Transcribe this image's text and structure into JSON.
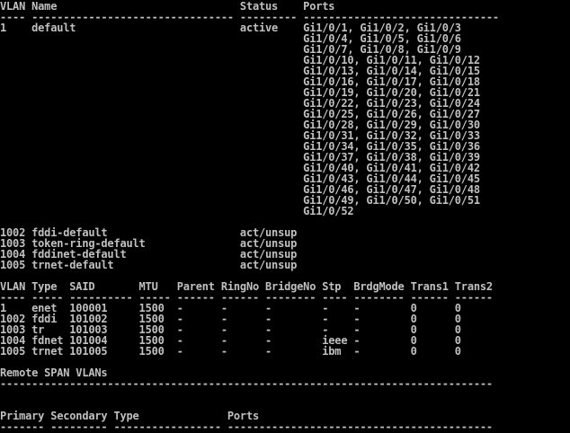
{
  "terminal": {
    "lines": [
      "VLAN Name                             Status    Ports",
      "---- -------------------------------- --------- -------------------------------",
      "1    default                          active    Gi1/0/1, Gi1/0/2, Gi1/0/3",
      "                                                Gi1/0/4, Gi1/0/5, Gi1/0/6",
      "                                                Gi1/0/7, Gi1/0/8, Gi1/0/9",
      "                                                Gi1/0/10, Gi1/0/11, Gi1/0/12",
      "                                                Gi1/0/13, Gi1/0/14, Gi1/0/15",
      "                                                Gi1/0/16, Gi1/0/17, Gi1/0/18",
      "                                                Gi1/0/19, Gi1/0/20, Gi1/0/21",
      "                                                Gi1/0/22, Gi1/0/23, Gi1/0/24",
      "                                                Gi1/0/25, Gi1/0/26, Gi1/0/27",
      "                                                Gi1/0/28, Gi1/0/29, Gi1/0/30",
      "                                                Gi1/0/31, Gi1/0/32, Gi1/0/33",
      "                                                Gi1/0/34, Gi1/0/35, Gi1/0/36",
      "                                                Gi1/0/37, Gi1/0/38, Gi1/0/39",
      "                                                Gi1/0/40, Gi1/0/41, Gi1/0/42",
      "                                                Gi1/0/43, Gi1/0/44, Gi1/0/45",
      "                                                Gi1/0/46, Gi1/0/47, Gi1/0/48",
      "                                                Gi1/0/49, Gi1/0/50, Gi1/0/51",
      "                                                Gi1/0/52",
      "",
      "1002 fddi-default                     act/unsup",
      "1003 token-ring-default               act/unsup",
      "1004 fddinet-default                  act/unsup",
      "1005 trnet-default                    act/unsup",
      "",
      "VLAN Type  SAID       MTU   Parent RingNo BridgeNo Stp  BrdgMode Trans1 Trans2",
      "---- ----- ---------- ----- ------ ------ -------- ---- -------- ------ ------",
      "1    enet  100001     1500  -      -      -        -    -        0      0",
      "1002 fddi  101002     1500  -      -      -        -    -        0      0",
      "1003 tr    101003     1500  -      -      -        -    -        0      0",
      "1004 fdnet 101004     1500  -      -      -        ieee -        0      0",
      "1005 trnet 101005     1500  -      -      -        ibm  -        0      0",
      "",
      "Remote SPAN VLANs",
      "------------------------------------------------------------------------------",
      "",
      "",
      "Primary Secondary Type              Ports",
      "------- --------- ----------------- ------------------------------------------"
    ]
  }
}
